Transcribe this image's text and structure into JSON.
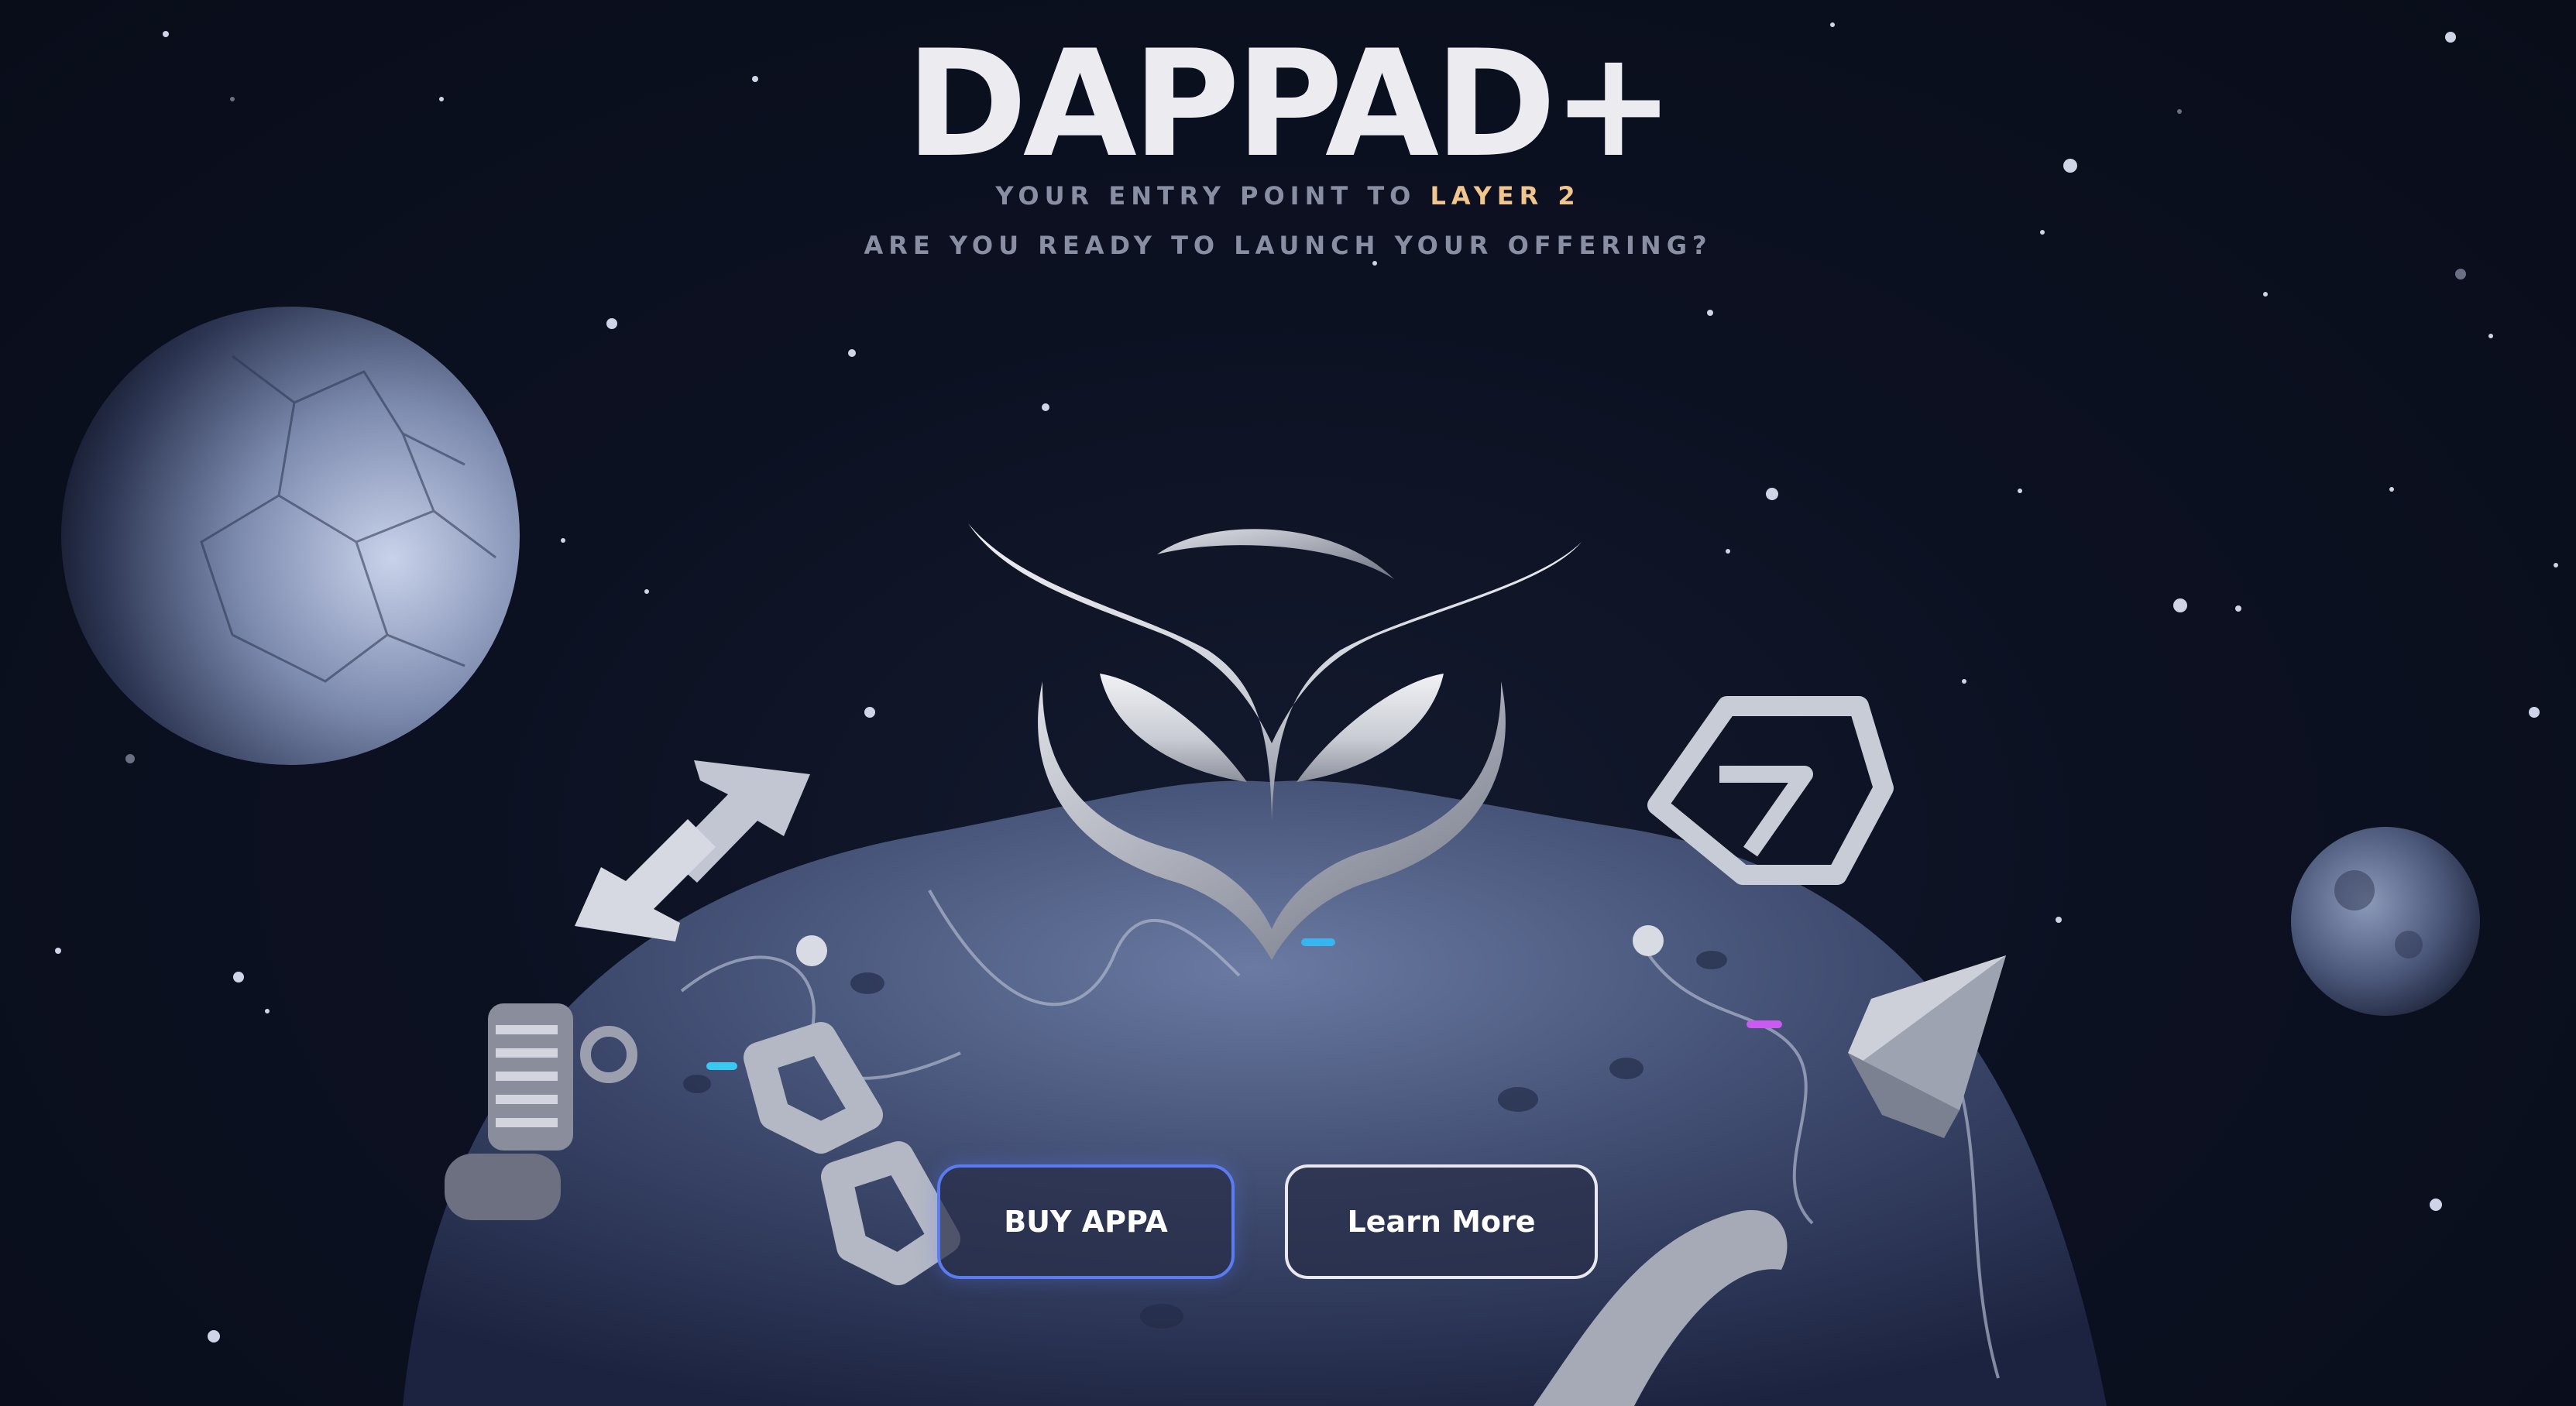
{
  "hero": {
    "title": "DAPPAD+",
    "tagline_prefix": "YOUR ENTRY POINT TO ",
    "tagline_accent": "LAYER 2",
    "subline": "ARE YOU READY TO LAUNCH YOUR OFFERING?"
  },
  "actions": {
    "buy_label": "BUY APPA",
    "learn_label": "Learn More"
  },
  "icons": [
    "owl-logo-icon",
    "swap-arrows-icon",
    "hexagon-logo-icon",
    "ethereum-icon",
    "chain-link-icon",
    "scroll-icon",
    "moon-icon",
    "small-moon-icon",
    "planet-icon"
  ],
  "colors": {
    "background": "#0b1020",
    "title": "#ececf0",
    "tagline": "#8a8ea2",
    "accent": "#f0c58e",
    "buy_border": "#5b7cf0",
    "learn_border": "#e8e8ee"
  }
}
